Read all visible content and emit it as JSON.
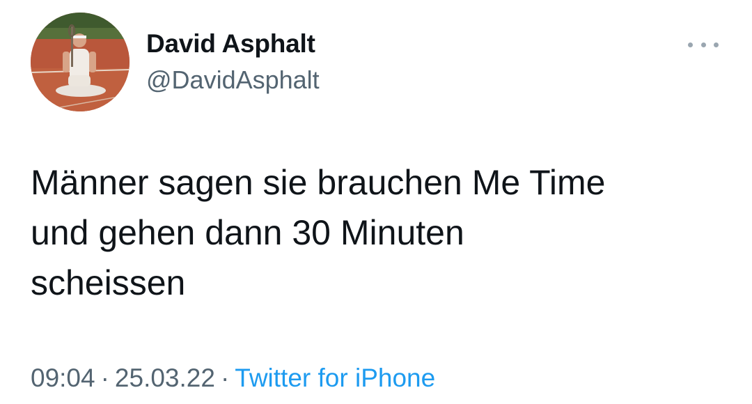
{
  "author": {
    "display_name": "David Asphalt",
    "handle": "@DavidAsphalt"
  },
  "tweet": {
    "lines": [
      "Männer sagen sie brauchen Me Time",
      "und gehen dann 30 Minuten",
      "scheissen"
    ]
  },
  "meta": {
    "time": "09:04",
    "date": "25.03.22",
    "separator": "·",
    "source": "Twitter for iPhone"
  },
  "icons": {
    "more": "more-horizontal-icon"
  },
  "colors": {
    "text": "#0f1419",
    "secondary": "#536471",
    "link": "#1d9bf0"
  }
}
